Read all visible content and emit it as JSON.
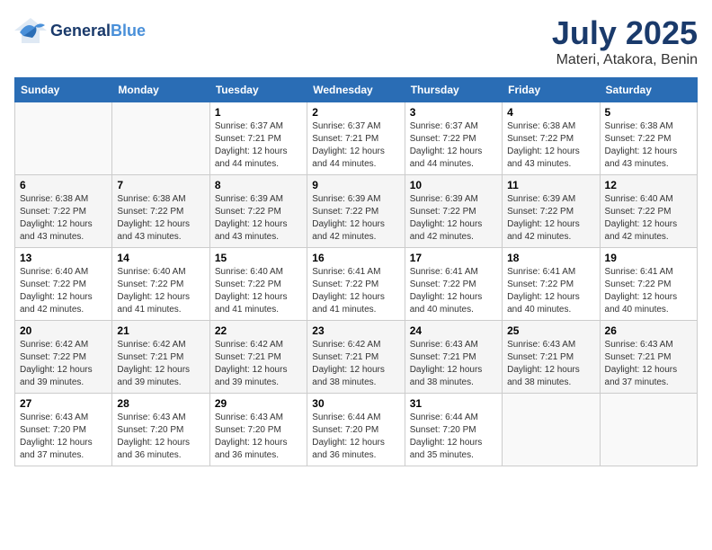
{
  "logo": {
    "general": "General",
    "blue": "Blue"
  },
  "header": {
    "month": "July 2025",
    "location": "Materi, Atakora, Benin"
  },
  "weekdays": [
    "Sunday",
    "Monday",
    "Tuesday",
    "Wednesday",
    "Thursday",
    "Friday",
    "Saturday"
  ],
  "weeks": [
    [
      {
        "day": "",
        "detail": ""
      },
      {
        "day": "",
        "detail": ""
      },
      {
        "day": "1",
        "detail": "Sunrise: 6:37 AM\nSunset: 7:21 PM\nDaylight: 12 hours and 44 minutes."
      },
      {
        "day": "2",
        "detail": "Sunrise: 6:37 AM\nSunset: 7:21 PM\nDaylight: 12 hours and 44 minutes."
      },
      {
        "day": "3",
        "detail": "Sunrise: 6:37 AM\nSunset: 7:22 PM\nDaylight: 12 hours and 44 minutes."
      },
      {
        "day": "4",
        "detail": "Sunrise: 6:38 AM\nSunset: 7:22 PM\nDaylight: 12 hours and 43 minutes."
      },
      {
        "day": "5",
        "detail": "Sunrise: 6:38 AM\nSunset: 7:22 PM\nDaylight: 12 hours and 43 minutes."
      }
    ],
    [
      {
        "day": "6",
        "detail": "Sunrise: 6:38 AM\nSunset: 7:22 PM\nDaylight: 12 hours and 43 minutes."
      },
      {
        "day": "7",
        "detail": "Sunrise: 6:38 AM\nSunset: 7:22 PM\nDaylight: 12 hours and 43 minutes."
      },
      {
        "day": "8",
        "detail": "Sunrise: 6:39 AM\nSunset: 7:22 PM\nDaylight: 12 hours and 43 minutes."
      },
      {
        "day": "9",
        "detail": "Sunrise: 6:39 AM\nSunset: 7:22 PM\nDaylight: 12 hours and 42 minutes."
      },
      {
        "day": "10",
        "detail": "Sunrise: 6:39 AM\nSunset: 7:22 PM\nDaylight: 12 hours and 42 minutes."
      },
      {
        "day": "11",
        "detail": "Sunrise: 6:39 AM\nSunset: 7:22 PM\nDaylight: 12 hours and 42 minutes."
      },
      {
        "day": "12",
        "detail": "Sunrise: 6:40 AM\nSunset: 7:22 PM\nDaylight: 12 hours and 42 minutes."
      }
    ],
    [
      {
        "day": "13",
        "detail": "Sunrise: 6:40 AM\nSunset: 7:22 PM\nDaylight: 12 hours and 42 minutes."
      },
      {
        "day": "14",
        "detail": "Sunrise: 6:40 AM\nSunset: 7:22 PM\nDaylight: 12 hours and 41 minutes."
      },
      {
        "day": "15",
        "detail": "Sunrise: 6:40 AM\nSunset: 7:22 PM\nDaylight: 12 hours and 41 minutes."
      },
      {
        "day": "16",
        "detail": "Sunrise: 6:41 AM\nSunset: 7:22 PM\nDaylight: 12 hours and 41 minutes."
      },
      {
        "day": "17",
        "detail": "Sunrise: 6:41 AM\nSunset: 7:22 PM\nDaylight: 12 hours and 40 minutes."
      },
      {
        "day": "18",
        "detail": "Sunrise: 6:41 AM\nSunset: 7:22 PM\nDaylight: 12 hours and 40 minutes."
      },
      {
        "day": "19",
        "detail": "Sunrise: 6:41 AM\nSunset: 7:22 PM\nDaylight: 12 hours and 40 minutes."
      }
    ],
    [
      {
        "day": "20",
        "detail": "Sunrise: 6:42 AM\nSunset: 7:22 PM\nDaylight: 12 hours and 39 minutes."
      },
      {
        "day": "21",
        "detail": "Sunrise: 6:42 AM\nSunset: 7:21 PM\nDaylight: 12 hours and 39 minutes."
      },
      {
        "day": "22",
        "detail": "Sunrise: 6:42 AM\nSunset: 7:21 PM\nDaylight: 12 hours and 39 minutes."
      },
      {
        "day": "23",
        "detail": "Sunrise: 6:42 AM\nSunset: 7:21 PM\nDaylight: 12 hours and 38 minutes."
      },
      {
        "day": "24",
        "detail": "Sunrise: 6:43 AM\nSunset: 7:21 PM\nDaylight: 12 hours and 38 minutes."
      },
      {
        "day": "25",
        "detail": "Sunrise: 6:43 AM\nSunset: 7:21 PM\nDaylight: 12 hours and 38 minutes."
      },
      {
        "day": "26",
        "detail": "Sunrise: 6:43 AM\nSunset: 7:21 PM\nDaylight: 12 hours and 37 minutes."
      }
    ],
    [
      {
        "day": "27",
        "detail": "Sunrise: 6:43 AM\nSunset: 7:20 PM\nDaylight: 12 hours and 37 minutes."
      },
      {
        "day": "28",
        "detail": "Sunrise: 6:43 AM\nSunset: 7:20 PM\nDaylight: 12 hours and 36 minutes."
      },
      {
        "day": "29",
        "detail": "Sunrise: 6:43 AM\nSunset: 7:20 PM\nDaylight: 12 hours and 36 minutes."
      },
      {
        "day": "30",
        "detail": "Sunrise: 6:44 AM\nSunset: 7:20 PM\nDaylight: 12 hours and 36 minutes."
      },
      {
        "day": "31",
        "detail": "Sunrise: 6:44 AM\nSunset: 7:20 PM\nDaylight: 12 hours and 35 minutes."
      },
      {
        "day": "",
        "detail": ""
      },
      {
        "day": "",
        "detail": ""
      }
    ]
  ]
}
